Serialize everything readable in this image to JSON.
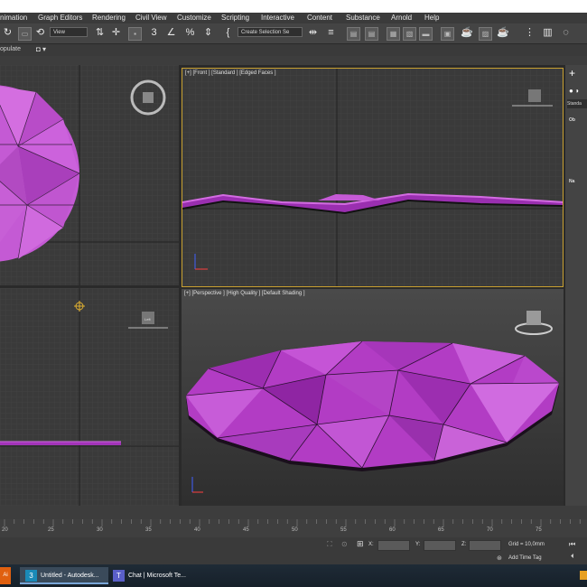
{
  "menu": [
    "nimation",
    "Graph Editors",
    "Rendering",
    "Civil View",
    "Customize",
    "Scripting",
    "Interactive",
    "Content",
    "Substance",
    "Arnold",
    "Help"
  ],
  "toolbar": {
    "view_dropdown": "View",
    "selection_set_dropdown": "Create Selection Se",
    "populate_label": "opulate"
  },
  "viewports": {
    "front_label": "[+] [Front ] [Standard ] [Edged Faces ]",
    "perspective_label": "[+] [Perspective ] [High Quality ] [Default Shading ]",
    "bottomleft_viewcube_text": "Left"
  },
  "command_panel": {
    "tab_plus": "+",
    "dropdown": "Standa",
    "rollout_object": "Ob",
    "rollout_name": "Na"
  },
  "timeline": {
    "ticks": [
      "20",
      "25",
      "30",
      "35",
      "40",
      "45",
      "50",
      "55",
      "60",
      "65",
      "70",
      "75"
    ]
  },
  "status": {
    "x_label": "X:",
    "y_label": "Y:",
    "z_label": "Z:",
    "grid": "Grid = 10,0mm",
    "add_time_tag": "Add Time Tag"
  },
  "taskbar": {
    "items": [
      "Untitled - Autodesk...",
      "Chat | Microsoft Te..."
    ]
  },
  "colors": {
    "mesh": "#b23cc4",
    "mesh_light": "#cf64dd",
    "viewport_bg": "#3a3a3a",
    "active_border": "#c8a030"
  }
}
